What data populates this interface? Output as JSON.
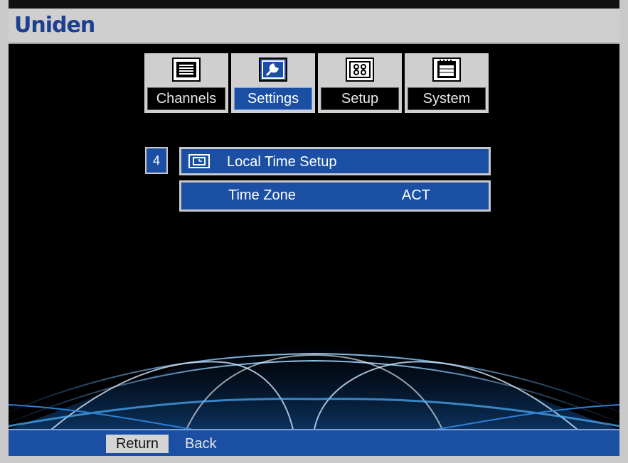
{
  "header": {
    "brand": "Uniden"
  },
  "tabs": [
    {
      "label": "Channels",
      "icon": "list-icon",
      "active": false
    },
    {
      "label": "Settings",
      "icon": "wrench-icon",
      "active": true
    },
    {
      "label": "Setup",
      "icon": "grid-icon",
      "active": false
    },
    {
      "label": "System",
      "icon": "calendar-icon",
      "active": false
    }
  ],
  "menu": {
    "index": "4",
    "title": "Local Time Setup",
    "title_icon": "clock-icon",
    "items": [
      {
        "label": "Time Zone",
        "value": "ACT"
      }
    ]
  },
  "footer": {
    "return_label": "Return",
    "back_label": "Back"
  },
  "colors": {
    "accent_blue": "#1a4fa3",
    "brand_blue": "#1c3f8f",
    "frame_gray": "#cfcfcf",
    "background": "#000000"
  }
}
